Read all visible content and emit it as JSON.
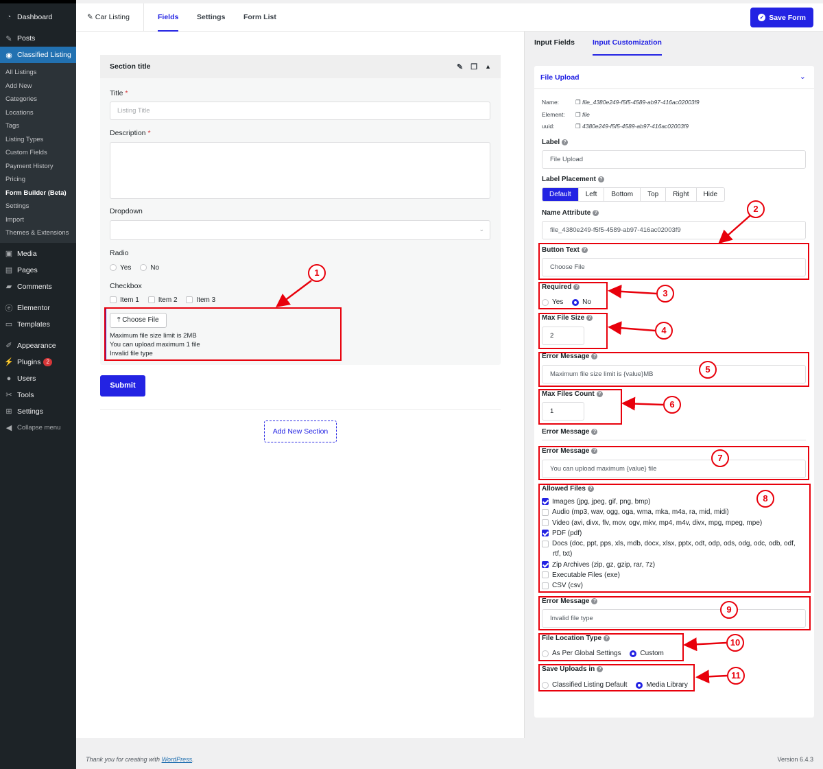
{
  "sidebar": {
    "items": [
      {
        "label": "Dashboard",
        "icon": "dashboard-icon"
      },
      {
        "label": "Posts",
        "icon": "pin-icon"
      },
      {
        "label": "Classified Listing",
        "icon": "location-icon"
      }
    ],
    "sub": [
      "All Listings",
      "Add New",
      "Categories",
      "Locations",
      "Tags",
      "Listing Types",
      "Custom Fields",
      "Payment History",
      "Pricing",
      "Form Builder (Beta)",
      "Settings",
      "Import",
      "Themes & Extensions"
    ],
    "items2": [
      {
        "label": "Media",
        "icon": "media-icon"
      },
      {
        "label": "Pages",
        "icon": "pages-icon"
      },
      {
        "label": "Comments",
        "icon": "comment-icon"
      },
      {
        "label": "Elementor",
        "icon": "elementor-icon"
      },
      {
        "label": "Templates",
        "icon": "folder-icon"
      },
      {
        "label": "Appearance",
        "icon": "brush-icon"
      },
      {
        "label": "Plugins",
        "icon": "plugin-icon",
        "badge": "2"
      },
      {
        "label": "Users",
        "icon": "user-icon"
      },
      {
        "label": "Tools",
        "icon": "wrench-icon"
      },
      {
        "label": "Settings",
        "icon": "settings-icon"
      },
      {
        "label": "Collapse menu",
        "icon": "collapse-icon"
      }
    ]
  },
  "topbar": {
    "form_name": "Car Listing",
    "tabs": [
      "Fields",
      "Settings",
      "Form List"
    ],
    "save": "Save Form"
  },
  "form": {
    "section_title": "Section title",
    "title_label": "Title",
    "title_placeholder": "Listing Title",
    "desc_label": "Description",
    "dropdown_label": "Dropdown",
    "radio_label": "Radio",
    "radio_opts": [
      "Yes",
      "No"
    ],
    "checkbox_label": "Checkbox",
    "checkbox_opts": [
      "Item 1",
      "Item 2",
      "Item 3"
    ],
    "choose_file": "Choose File",
    "file_notes": [
      "Maximum file size limit is 2MB",
      "You can upload maximum 1 file",
      "Invalid file type"
    ],
    "submit": "Submit",
    "add_section": "Add New Section"
  },
  "right": {
    "tabs": [
      "Input Fields",
      "Input Customization"
    ],
    "panel_title": "File Upload",
    "meta": [
      {
        "k": "Name:",
        "v": "file_4380e249-f5f5-4589-ab97-416ac02003f9"
      },
      {
        "k": "Element:",
        "v": "file"
      },
      {
        "k": "uuid:",
        "v": "4380e249-f5f5-4589-ab97-416ac02003f9"
      }
    ],
    "label": "Label",
    "label_value": "File Upload",
    "placement": "Label Placement",
    "placement_opts": [
      "Default",
      "Left",
      "Bottom",
      "Top",
      "Right",
      "Hide"
    ],
    "name_attr": "Name Attribute",
    "name_value": "file_4380e249-f5f5-4589-ab97-416ac02003f9",
    "button_text": "Button Text",
    "button_value": "Choose File",
    "required": "Required",
    "required_opts": [
      "Yes",
      "No"
    ],
    "max_size": "Max File Size",
    "max_size_value": "2",
    "error_message": "Error Message",
    "size_error": "Maximum file size limit is {value}MB",
    "max_count": "Max Files Count",
    "max_count_value": "1",
    "count_error": "You can upload maximum {value} file",
    "allowed": "Allowed Files",
    "allowed_opts": [
      {
        "label": "Images (jpg, jpeg, gif, png, bmp)",
        "checked": true
      },
      {
        "label": "Audio (mp3, wav, ogg, oga, wma, mka, m4a, ra, mid, midi)",
        "checked": false
      },
      {
        "label": "Video (avi, divx, flv, mov, ogv, mkv, mp4, m4v, divx, mpg, mpeg, mpe)",
        "checked": false
      },
      {
        "label": "PDF (pdf)",
        "checked": true
      },
      {
        "label": "Docs (doc, ppt, pps, xls, mdb, docx, xlsx, pptx, odt, odp, ods, odg, odc, odb, odf,",
        "checked": false
      },
      {
        "label": "rtf, txt)",
        "checked": null
      },
      {
        "label": "Zip Archives (zip, gz, gzip, rar, 7z)",
        "checked": true
      },
      {
        "label": "Executable Files (exe)",
        "checked": false
      },
      {
        "label": "CSV (csv)",
        "checked": false
      }
    ],
    "type_error": "Invalid file type",
    "location": "File Location Type",
    "location_opts": [
      "As Per Global Settings",
      "Custom"
    ],
    "uploads": "Save Uploads in",
    "uploads_opts": [
      "Classified Listing Default",
      "Media Library"
    ]
  },
  "annotations": [
    "1",
    "2",
    "3",
    "4",
    "5",
    "6",
    "7",
    "8",
    "9",
    "10",
    "11"
  ],
  "footer": {
    "thanks": "Thank you for creating with ",
    "wp": "WordPress",
    "dot": ".",
    "version": "Version 6.4.3"
  }
}
